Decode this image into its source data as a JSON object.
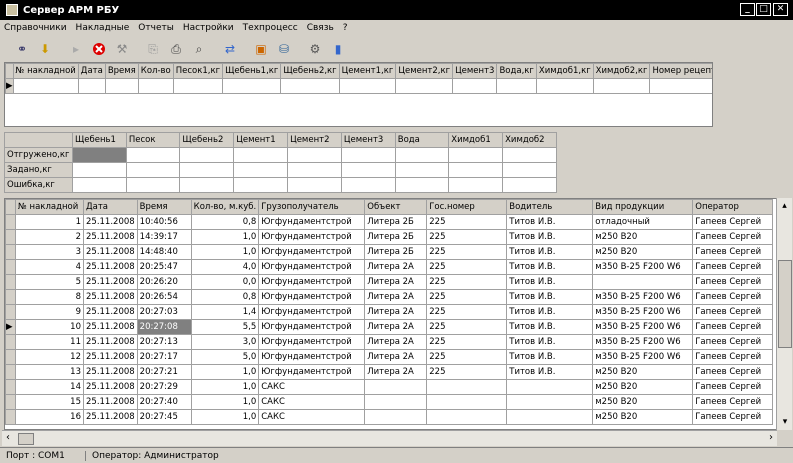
{
  "window": {
    "title": "Сервер АРМ РБУ",
    "min": "_",
    "max": "□",
    "close": "✕"
  },
  "menu": [
    "Справочники",
    "Накладные",
    "Отчеты",
    "Настройки",
    "Техпроцесс",
    "Связь",
    "?"
  ],
  "toolbar_icons": [
    "connect-icon",
    "download-icon",
    "arrow-icon",
    "stop-icon",
    "pick-icon",
    "copy-icon",
    "print-icon",
    "preview-icon",
    "transfer-icon",
    "export-icon",
    "db-icon",
    "settings-icon",
    "battery-icon"
  ],
  "top_grid": {
    "headers": [
      "№ накладной",
      "Дата",
      "Время",
      "Кол-во",
      "Песок1,кг",
      "Щебень1,кг",
      "Щебень2,кг",
      "Цемент1,кг",
      "Цемент2,кг",
      "Цемент3",
      "Вода,кг",
      "Химдоб1,кг",
      "Химдоб2,кг",
      "Номер рецепта"
    ]
  },
  "mid_grid": {
    "headers": [
      "Щебень1",
      "Песок",
      "Щебень2",
      "Цемент1",
      "Цемент2",
      "Цемент3",
      "Вода",
      "Химдоб1",
      "Химдоб2"
    ],
    "rows": [
      "Отгружено,кг",
      "Задано,кг",
      "Ошибка,кг"
    ]
  },
  "bottom_grid": {
    "headers": [
      "№ накладной",
      "Дата",
      "Время",
      "Кол-во, м.куб.",
      "Грузополучатель",
      "Объект",
      "Гос.номер",
      "Водитель",
      "Вид продукции",
      "Оператор"
    ],
    "rows": [
      [
        "1",
        "25.11.2008",
        "10:40:56",
        "0,8",
        "Югфундаментстрой",
        "Литера 2Б",
        "225",
        "Титов И.В.",
        "отладочный",
        "Гапеев Сергей"
      ],
      [
        "2",
        "25.11.2008",
        "14:39:17",
        "1,0",
        "Югфундаментстрой",
        "Литера 2Б",
        "225",
        "Титов И.В.",
        "м250 В20",
        "Гапеев Сергей"
      ],
      [
        "3",
        "25.11.2008",
        "14:48:40",
        "1,0",
        "Югфундаментстрой",
        "Литера 2Б",
        "225",
        "Титов И.В.",
        "м250 В20",
        "Гапеев Сергей"
      ],
      [
        "4",
        "25.11.2008",
        "20:25:47",
        "4,0",
        "Югфундаментстрой",
        "Литера 2А",
        "225",
        "Титов И.В.",
        "м350 В-25 F200 W6",
        "Гапеев Сергей"
      ],
      [
        "5",
        "25.11.2008",
        "20:26:20",
        "0,0",
        "Югфундаментстрой",
        "Литера 2А",
        "225",
        "Титов И.В.",
        "",
        "Гапеев Сергей"
      ],
      [
        "8",
        "25.11.2008",
        "20:26:54",
        "0,8",
        "Югфундаментстрой",
        "Литера 2А",
        "225",
        "Титов И.В.",
        "м350 В-25 F200 W6",
        "Гапеев Сергей"
      ],
      [
        "9",
        "25.11.2008",
        "20:27:03",
        "1,4",
        "Югфундаментстрой",
        "Литера 2А",
        "225",
        "Титов И.В.",
        "м350 В-25 F200 W6",
        "Гапеев Сергей"
      ],
      [
        "10",
        "25.11.2008",
        "20:27:08",
        "5,5",
        "Югфундаментстрой",
        "Литера 2А",
        "225",
        "Титов И.В.",
        "м350 В-25 F200 W6",
        "Гапеев Сергей"
      ],
      [
        "11",
        "25.11.2008",
        "20:27:13",
        "3,0",
        "Югфундаментстрой",
        "Литера 2А",
        "225",
        "Титов И.В.",
        "м350 В-25 F200 W6",
        "Гапеев Сергей"
      ],
      [
        "12",
        "25.11.2008",
        "20:27:17",
        "5,0",
        "Югфундаментстрой",
        "Литера 2А",
        "225",
        "Титов И.В.",
        "м350 В-25 F200 W6",
        "Гапеев Сергей"
      ],
      [
        "13",
        "25.11.2008",
        "20:27:21",
        "1,0",
        "Югфундаментстрой",
        "Литера 2А",
        "225",
        "Титов И.В.",
        "м250 В20",
        "Гапеев Сергей"
      ],
      [
        "14",
        "25.11.2008",
        "20:27:29",
        "1,0",
        "САКС",
        "",
        "",
        "",
        "м250 В20",
        "Гапеев Сергей"
      ],
      [
        "15",
        "25.11.2008",
        "20:27:40",
        "1,0",
        "САКС",
        "",
        "",
        "",
        "м250 В20",
        "Гапеев Сергей"
      ],
      [
        "16",
        "25.11.2008",
        "20:27:45",
        "1,0",
        "САКС",
        "",
        "",
        "",
        "м250 В20",
        "Гапеев Сергей"
      ]
    ],
    "selected_row": 7
  },
  "status": {
    "port": "Порт : COM1",
    "operator": "Оператор: Администратор"
  }
}
